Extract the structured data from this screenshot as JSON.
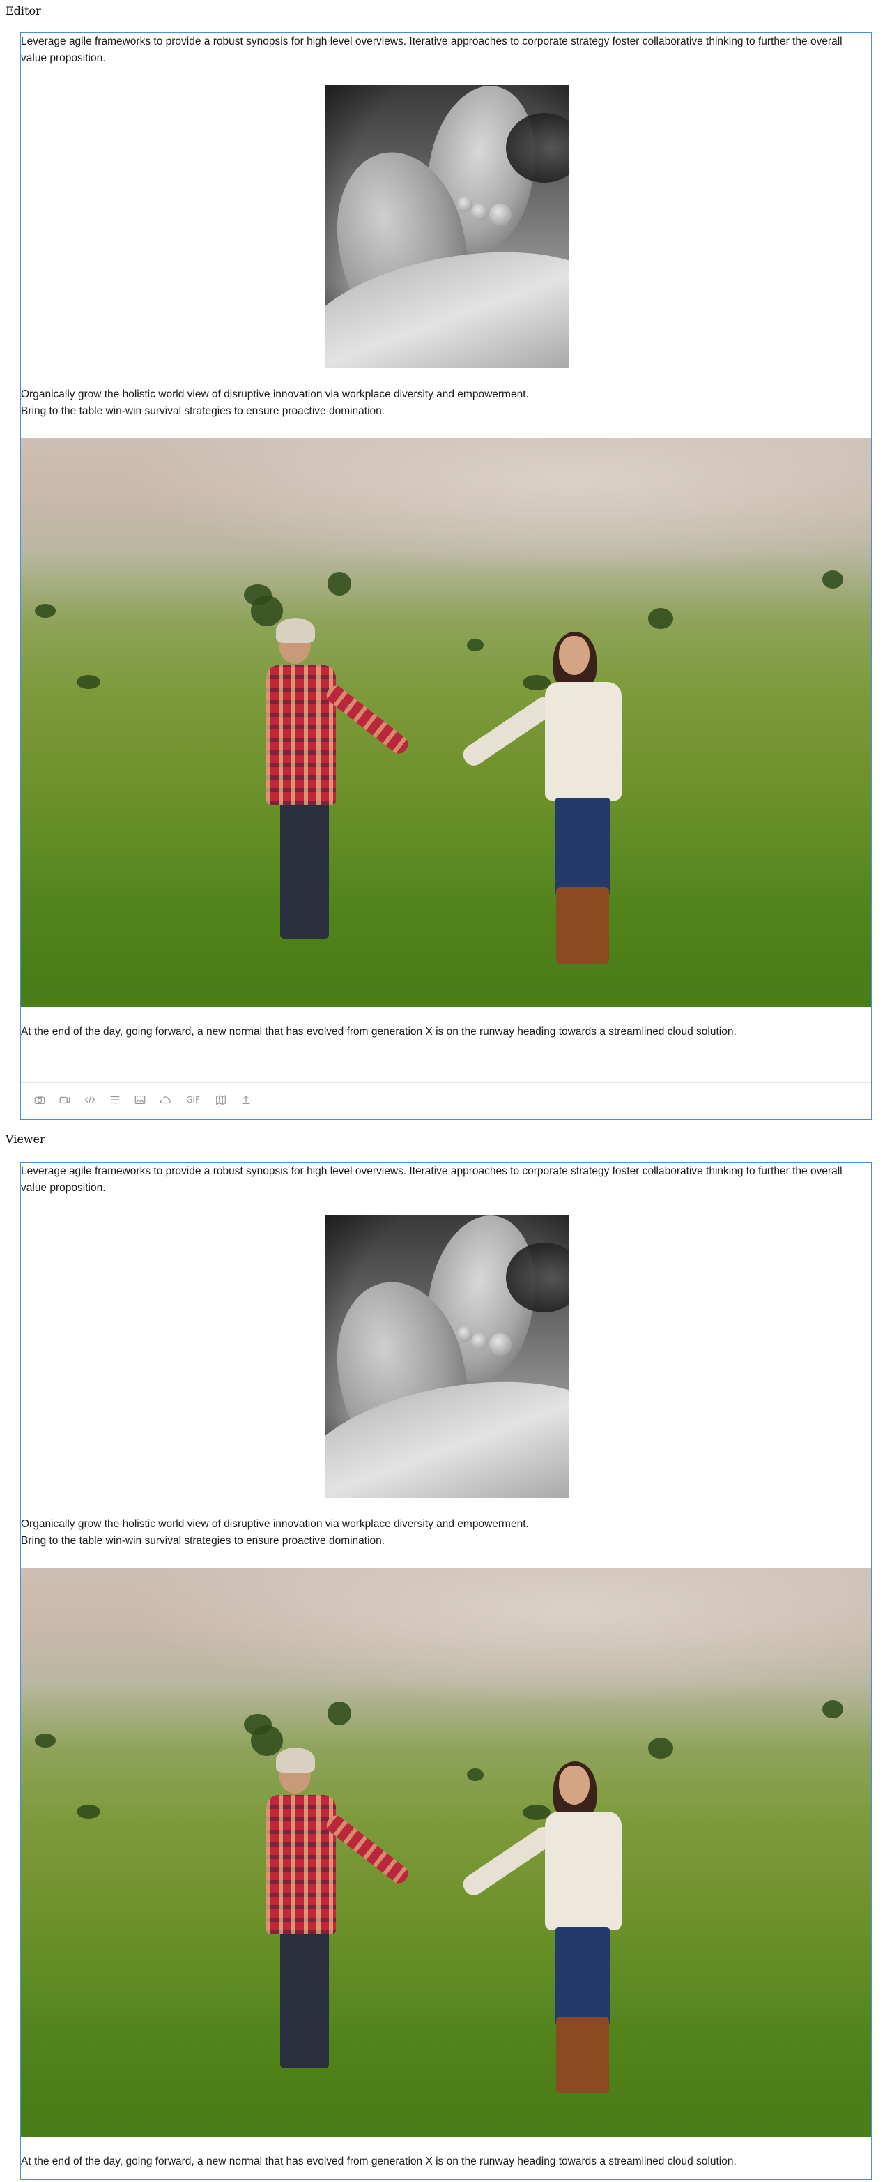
{
  "editor": {
    "section_label": "Editor",
    "paragraphs": {
      "p1": "Leverage agile frameworks to provide a robust synopsis for high level overviews. Iterative approaches to corporate strategy foster collaborative thinking to further the overall value proposition.",
      "p2a": "Organically grow the holistic world view of disruptive innovation via workplace diversity and empowerment.",
      "p2b": "Bring to the table win-win survival strategies to ensure proactive domination.",
      "p3": "At the end of the day, going forward, a new normal that has evolved from generation X is on the runway heading towards a streamlined cloud solution."
    },
    "toolbar": {
      "buttons": [
        {
          "icon": "camera-icon"
        },
        {
          "icon": "video-icon"
        },
        {
          "icon": "code-icon"
        },
        {
          "icon": "divider-icon"
        },
        {
          "icon": "image-icon"
        },
        {
          "icon": "soundcloud-icon"
        },
        {
          "icon": "gif-icon",
          "label": "GIF"
        },
        {
          "icon": "map-icon"
        },
        {
          "icon": "upload-icon"
        }
      ]
    }
  },
  "viewer": {
    "section_label": "Viewer",
    "paragraphs": {
      "p1": "Leverage agile frameworks to provide a robust synopsis for high level overviews. Iterative approaches to corporate strategy foster collaborative thinking to further the overall value proposition.",
      "p2a": "Organically grow the holistic world view of disruptive innovation via workplace diversity and empowerment.",
      "p2b": "Bring to the table win-win survival strategies to ensure proactive domination.",
      "p3": "At the end of the day, going forward, a new normal that has evolved from generation X is on the runway heading towards a streamlined cloud solution."
    }
  },
  "colors": {
    "frame_border": "#4a90d9",
    "toolbar_icon": "#9a9a9a"
  }
}
